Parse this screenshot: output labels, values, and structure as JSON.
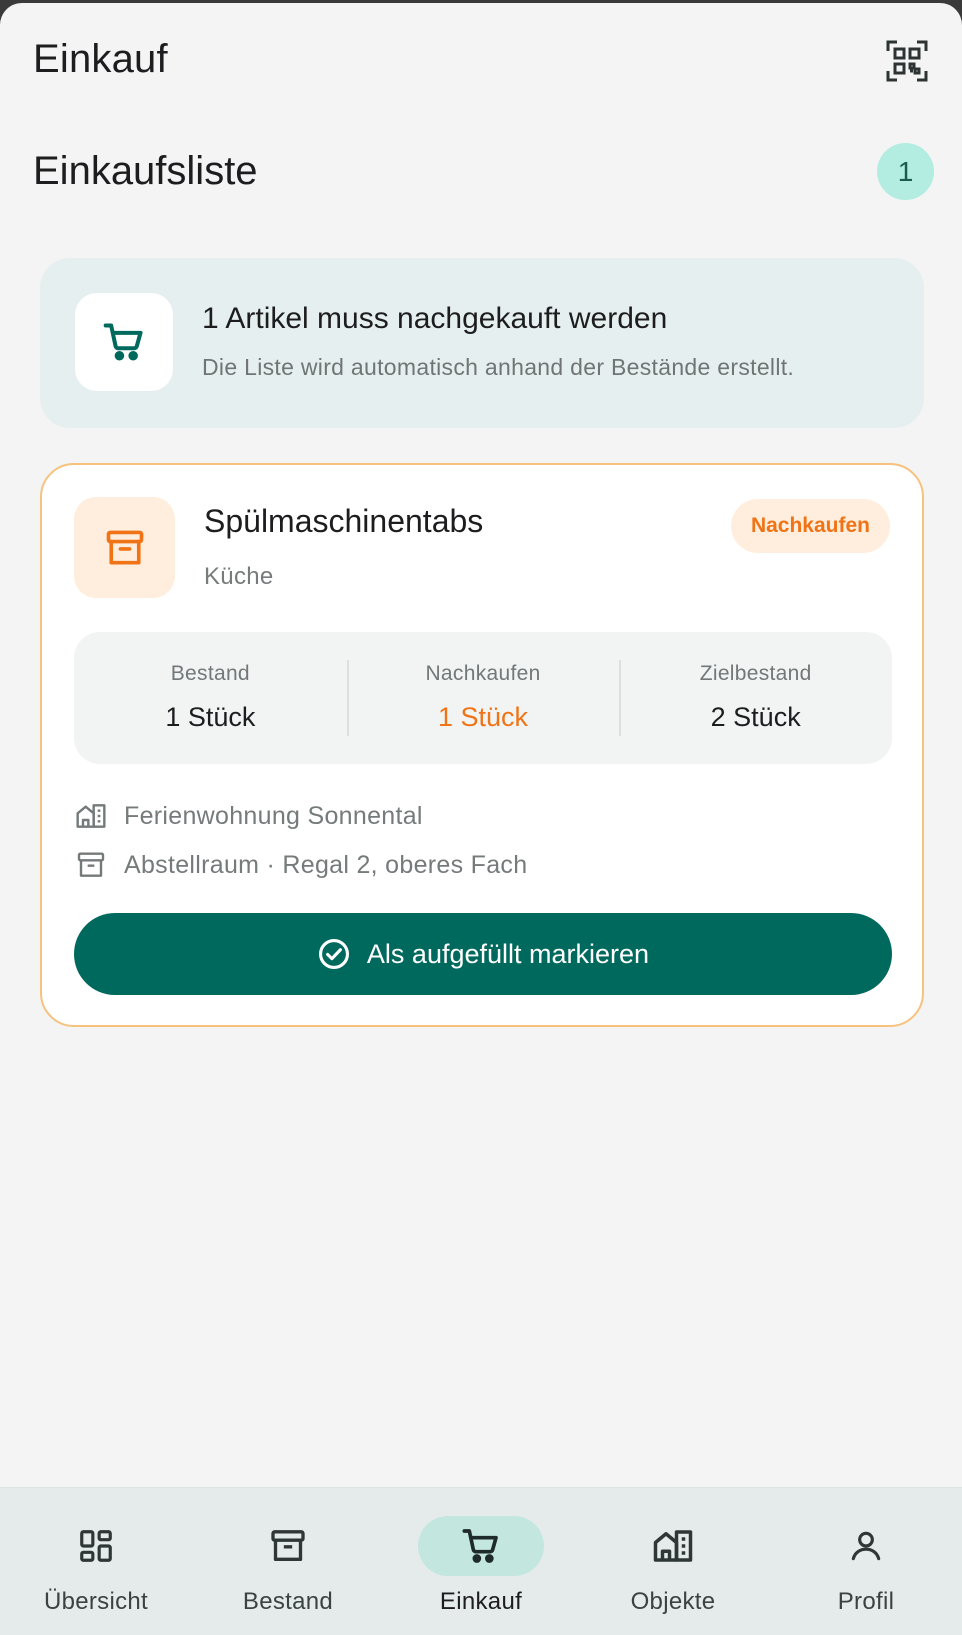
{
  "header": {
    "title": "Einkauf",
    "qr_icon": "qr-code-scan-icon"
  },
  "section": {
    "title": "Einkaufsliste",
    "count": "1"
  },
  "info": {
    "icon": "shopping-cart-icon",
    "title": "1 Artikel muss nachgekauft werden",
    "subtitle": "Die Liste wird automatisch anhand der Bestände erstellt."
  },
  "item": {
    "icon": "archive-box-icon",
    "name": "Spülmaschinentabs",
    "room": "Küche",
    "status": "Nachkaufen",
    "stats": [
      {
        "label": "Bestand",
        "value": "1 Stück"
      },
      {
        "label": "Nachkaufen",
        "value": "1 Stück"
      },
      {
        "label": "Zielbestand",
        "value": "2 Stück"
      }
    ],
    "property": "Ferienwohnung Sonnental",
    "storage": "Abstellraum · Regal 2, oberes Fach",
    "action": "Als aufgefüllt markieren"
  },
  "nav": [
    {
      "label": "Übersicht",
      "icon": "dashboard-icon"
    },
    {
      "label": "Bestand",
      "icon": "archive-box-icon"
    },
    {
      "label": "Einkauf",
      "icon": "shopping-cart-icon",
      "active": true
    },
    {
      "label": "Objekte",
      "icon": "buildings-icon"
    },
    {
      "label": "Profil",
      "icon": "user-icon"
    }
  ],
  "colors": {
    "primary": "#00695d",
    "accent": "#f07316",
    "badge": "#b3ece0",
    "card_border": "#f7c27e"
  }
}
